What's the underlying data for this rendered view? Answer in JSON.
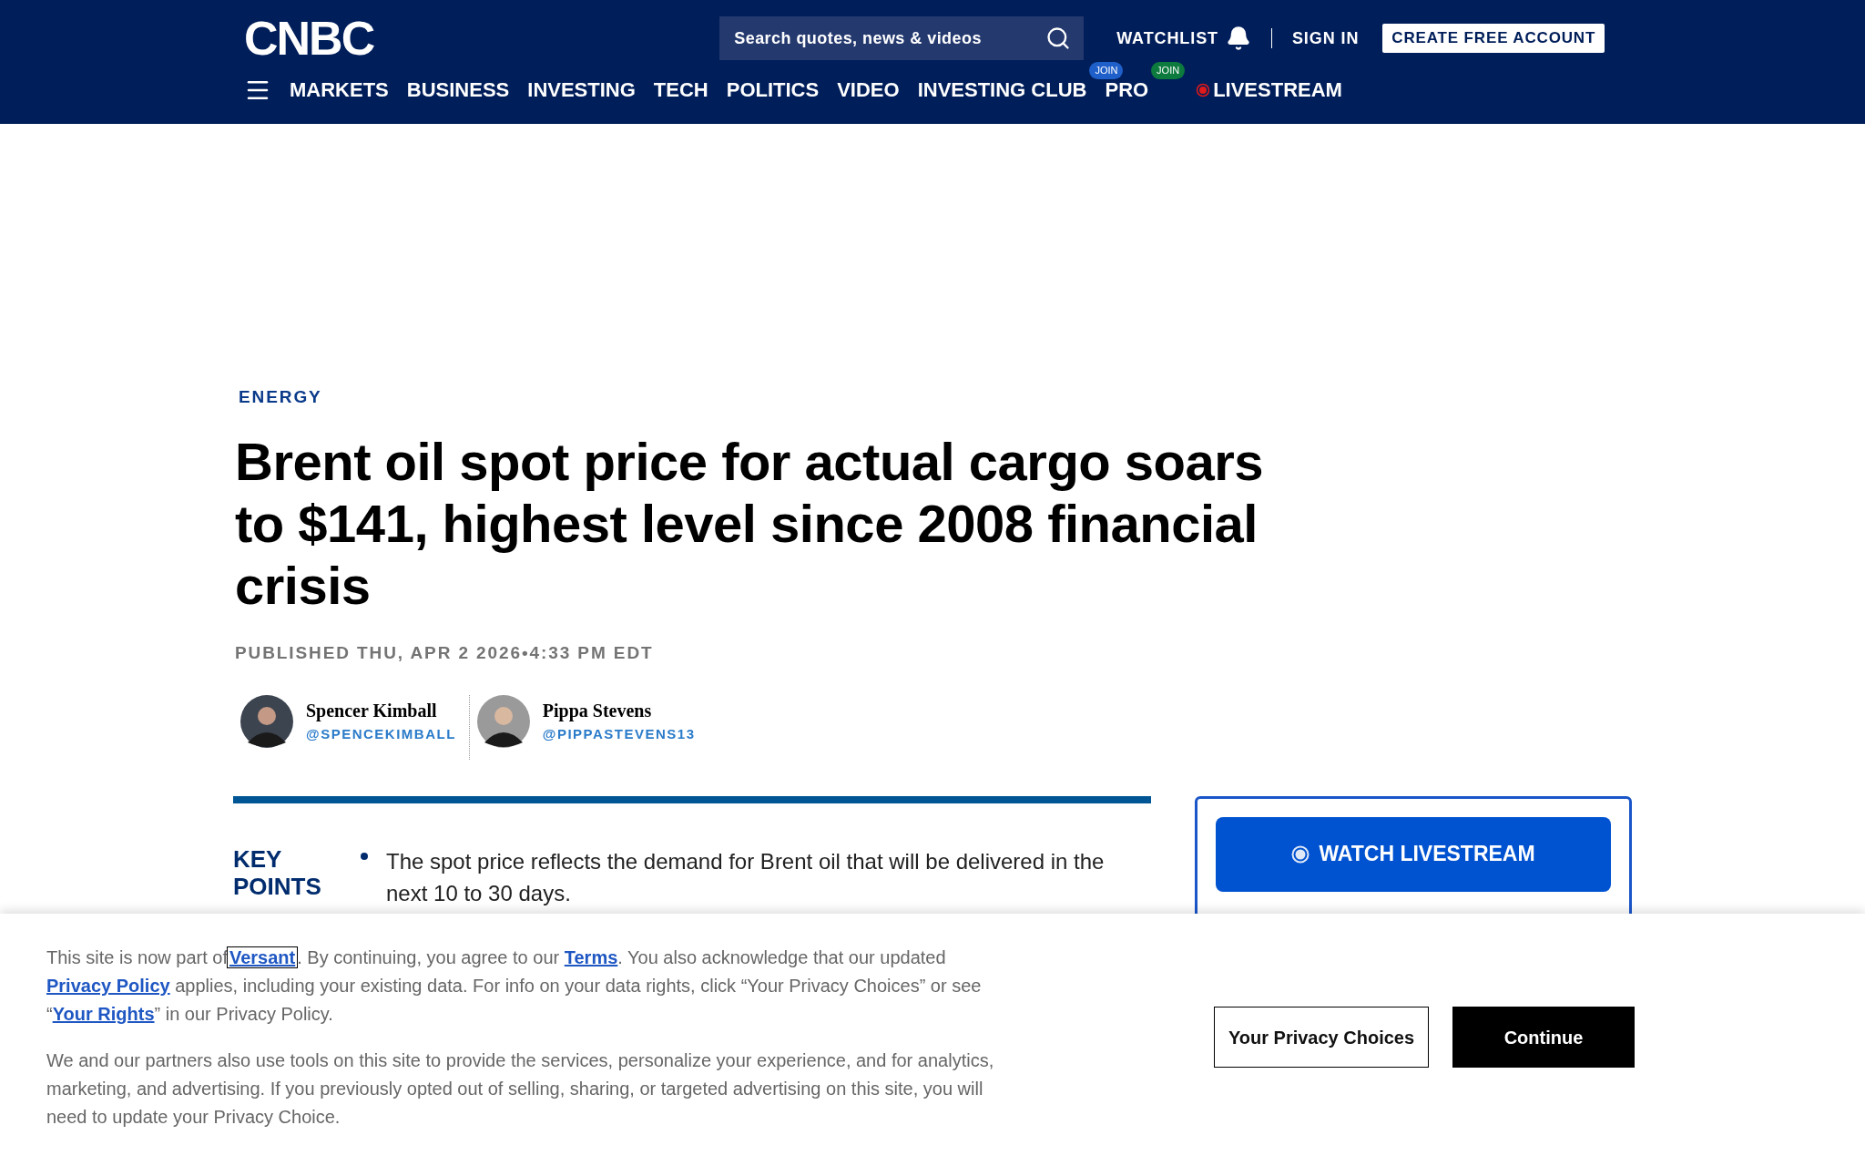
{
  "header": {
    "logo": "CNBC",
    "search": {
      "placeholder": "Search quotes, news & videos"
    },
    "watchlist": "WATCHLIST",
    "sign_in": "SIGN IN",
    "create_account": "CREATE FREE ACCOUNT",
    "nav": [
      {
        "label": "MARKETS",
        "kind": "plain"
      },
      {
        "label": "BUSINESS",
        "kind": "plain"
      },
      {
        "label": "INVESTING",
        "kind": "plain"
      },
      {
        "label": "TECH",
        "kind": "plain"
      },
      {
        "label": "POLITICS",
        "kind": "plain"
      },
      {
        "label": "VIDEO",
        "kind": "plain"
      },
      {
        "label": "INVESTING CLUB",
        "kind": "badge",
        "badge": "JOIN",
        "color": "#1f5fc9"
      },
      {
        "label": "PRO",
        "kind": "badge",
        "badge": "JOIN",
        "color": "#0d7a3e"
      },
      {
        "label": "LIVESTREAM",
        "kind": "live"
      }
    ]
  },
  "article": {
    "section": "ENERGY",
    "headline": "Brent oil spot price for actual cargo soars to $141, highest level since 2008 financial crisis",
    "published": "PUBLISHED THU, APR 2 2026•4:33 PM EDT",
    "authors": [
      {
        "name": "Spencer Kimball",
        "handle": "@SPENCEKIMBALL"
      },
      {
        "name": "Pippa Stevens",
        "handle": "@PIPPASTEVENS13"
      }
    ],
    "key_points": {
      "title": "KEY POINTS",
      "items": [
        "The spot price reflects the demand for Brent oil that will be delivered in the next 10 to 30 days."
      ]
    }
  },
  "sidebar": {
    "watch_button": "WATCH LIVESTREAM"
  },
  "consent": {
    "paragraphs": [
      [
        {
          "kind": "text",
          "text": "This site is now part of"
        },
        {
          "kind": "link",
          "text": "Versant",
          "focused": true
        },
        {
          "kind": "text",
          "text": ". By continuing, you agree to our "
        },
        {
          "kind": "link",
          "text": "Terms",
          "focused": false
        },
        {
          "kind": "text",
          "text": ". You also acknowledge that our updated "
        },
        {
          "kind": "link",
          "text": "Privacy Policy",
          "focused": false
        },
        {
          "kind": "text",
          "text": " applies, including your existing data. For info on your data rights, click “Your Privacy Choices” or see “"
        },
        {
          "kind": "link",
          "text": "Your Rights",
          "focused": false
        },
        {
          "kind": "text",
          "text": "” in our Privacy Policy."
        }
      ],
      [
        {
          "kind": "text",
          "text": "We and our partners also use tools on this site to provide the services, personalize your experience, and for analytics, marketing, and advertising. If you previously opted out of selling, sharing, or targeted advertising on this site, you will need to update your Privacy Choice."
        }
      ]
    ],
    "privacy_button": "Your Privacy Choices",
    "continue_button": "Continue"
  }
}
